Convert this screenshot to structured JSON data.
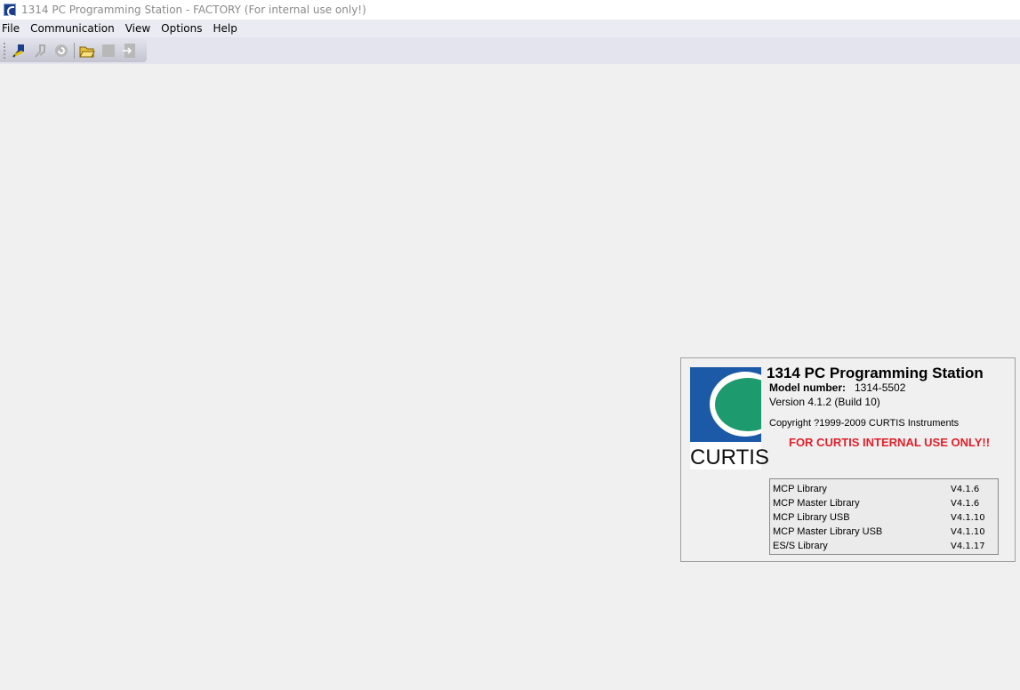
{
  "window": {
    "title": "1314 PC Programming Station - FACTORY (For internal use only!)"
  },
  "menu": [
    "File",
    "Communication",
    "View",
    "Options",
    "Help"
  ],
  "toolbar": {
    "icons": [
      "connect-icon",
      "disconnect-icon",
      "refresh-icon",
      "open-folder-icon",
      "stop-icon",
      "exit-icon"
    ]
  },
  "about": {
    "logo_text": "CURTIS",
    "product": "1314 PC Programming Station",
    "model_label": "Model number:",
    "model_value": "1314-5502",
    "version": "Version 4.1.2 (Build 10)",
    "copyright": "Copyright ?1999-2009 CURTIS Instruments",
    "internal": "FOR CURTIS INTERNAL USE ONLY!!",
    "libraries": [
      {
        "name": "MCP Library",
        "version": "V4.1.6"
      },
      {
        "name": "MCP Master Library",
        "version": "V4.1.6"
      },
      {
        "name": "MCP Library USB",
        "version": "V4.1.10"
      },
      {
        "name": "MCP Master Library USB",
        "version": "V4.1.10"
      },
      {
        "name": "ES/S Library",
        "version": "V4.1.17"
      }
    ]
  }
}
